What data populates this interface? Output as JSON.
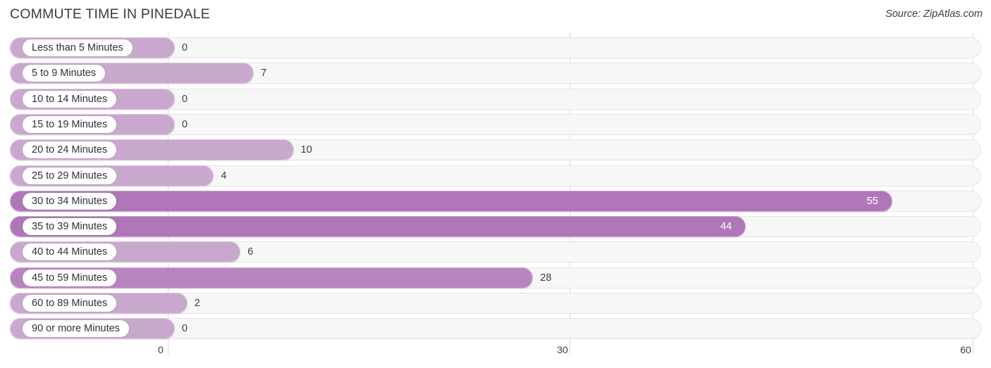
{
  "header": {
    "title": "COMMUTE TIME IN PINEDALE",
    "source": "Source: ZipAtlas.com"
  },
  "colors": {
    "bar_light": "#c9a8ce",
    "bar_dark": "#b077b8",
    "track": "#f7f7f7",
    "track_border": "#e3e3e3",
    "gridline": "#d9d9d9",
    "text": "#3b3b46",
    "value_inside": "#ffffff",
    "pill_background": "#ffffff"
  },
  "chart_data": {
    "type": "bar",
    "orientation": "horizontal",
    "title": "COMMUTE TIME IN PINEDALE",
    "xlabel": "",
    "ylabel": "",
    "xlim": [
      0,
      60
    ],
    "ticks": [
      0,
      30,
      60
    ],
    "tick_labels": [
      "0",
      "30",
      "60"
    ],
    "grid": true,
    "legend": false,
    "categories": [
      "Less than 5 Minutes",
      "5 to 9 Minutes",
      "10 to 14 Minutes",
      "15 to 19 Minutes",
      "20 to 24 Minutes",
      "25 to 29 Minutes",
      "30 to 34 Minutes",
      "35 to 39 Minutes",
      "40 to 44 Minutes",
      "45 to 59 Minutes",
      "60 to 89 Minutes",
      "90 or more Minutes"
    ],
    "values": [
      0,
      7,
      0,
      0,
      10,
      4,
      55,
      44,
      6,
      28,
      2,
      0
    ],
    "value_labels": [
      "0",
      "7",
      "0",
      "0",
      "10",
      "4",
      "55",
      "44",
      "6",
      "28",
      "2",
      "0"
    ]
  }
}
